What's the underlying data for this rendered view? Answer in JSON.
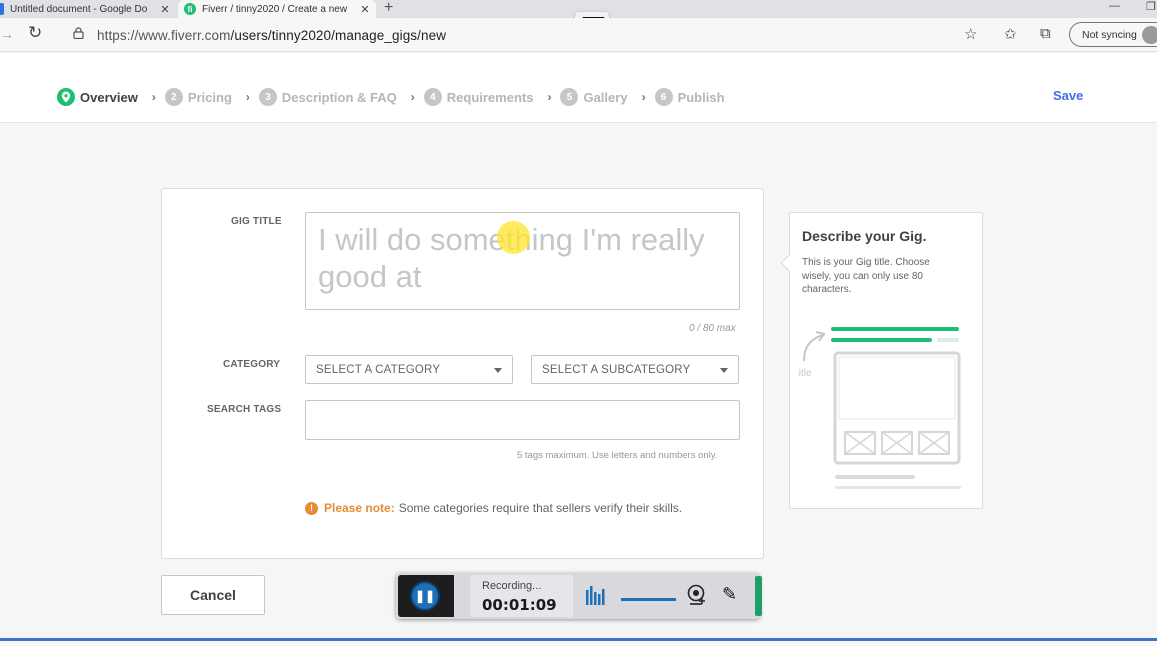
{
  "browser": {
    "tabs": [
      {
        "title": "Untitled document - Google Do",
        "close": "✕"
      },
      {
        "title": "Fiverr / tinny2020 / Create a new",
        "close": "✕",
        "favicon": "fi"
      }
    ],
    "new_tab": "+",
    "url_host": "https://www.fiverr.com",
    "url_path": "/users/tinny2020/manage_gigs/new",
    "sync_label": "Not syncing"
  },
  "steps": [
    {
      "num": "",
      "label": "Overview",
      "active": true
    },
    {
      "num": "2",
      "label": "Pricing"
    },
    {
      "num": "3",
      "label": "Description & FAQ"
    },
    {
      "num": "4",
      "label": "Requirements"
    },
    {
      "num": "5",
      "label": "Gallery"
    },
    {
      "num": "6",
      "label": "Publish"
    }
  ],
  "step_separator": "›",
  "save_label": "Save",
  "form": {
    "gig_title_label": "GIG TITLE",
    "gig_title_placeholder": "I will do something I'm really good at",
    "counter": "0 / 80 max",
    "category_label": "CATEGORY",
    "category_placeholder": "SELECT A CATEGORY",
    "subcategory_placeholder": "SELECT A SUBCATEGORY",
    "tags_label": "SEARCH TAGS",
    "tags_hint": "5 tags maximum. Use letters and numbers only.",
    "note_title": "Please note:",
    "note_text": "Some categories require that sellers verify their skills."
  },
  "help": {
    "title": "Describe your Gig.",
    "text": "This is your Gig title. Choose wisely, you can only use 80 characters.",
    "illo_word": "title"
  },
  "cancel_label": "Cancel",
  "recorder": {
    "status": "Recording...",
    "time": "00:01:09"
  },
  "colors": {
    "accent_green": "#1dbf73",
    "link_blue": "#446ee7",
    "warning_orange": "#e58c35"
  }
}
